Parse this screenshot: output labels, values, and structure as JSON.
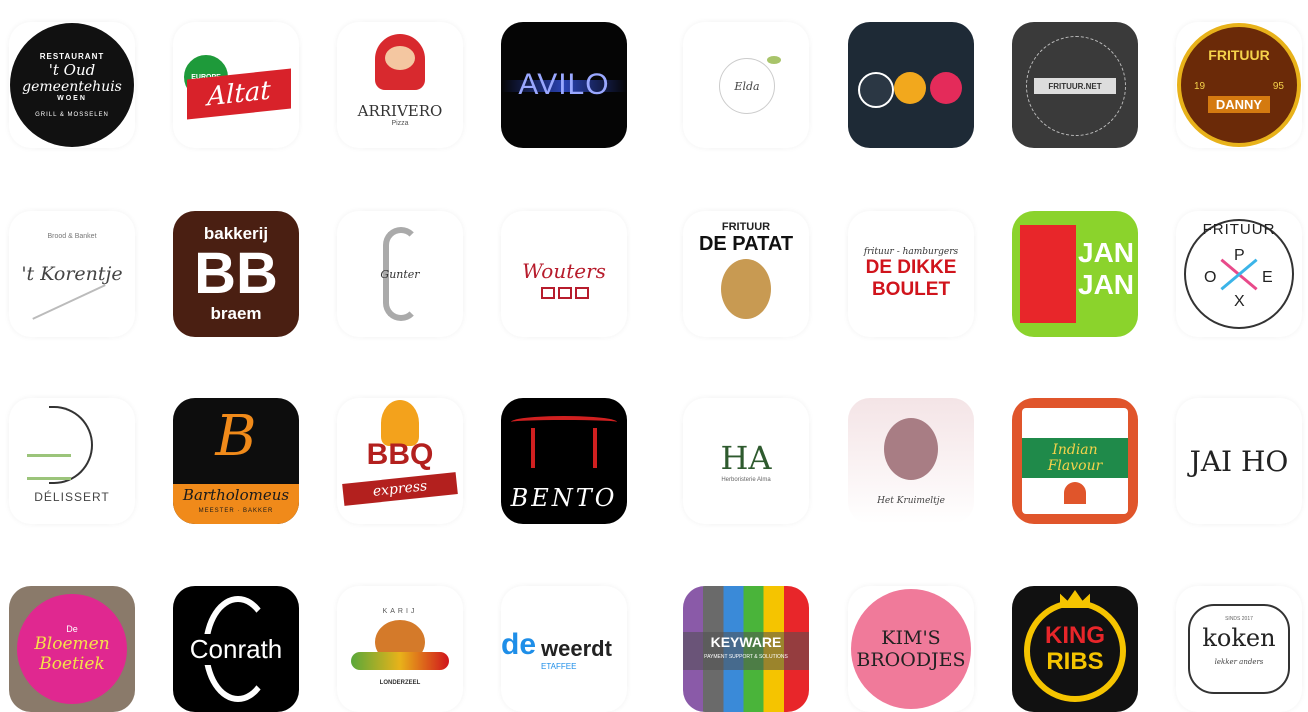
{
  "logos": {
    "oud_gemeentehuis": {
      "top": "RESTAURANT",
      "line1": "'t Oud",
      "line2": "gemeentehuis",
      "line3": "WOEN",
      "bottom": "GRILL & MOSSELEN"
    },
    "altat": {
      "badge": "EUROPE",
      "name": "Altat"
    },
    "arrivero": {
      "name": "ARRIVERO",
      "sub": "Pizza"
    },
    "avilo": {
      "name": "AVILO"
    },
    "elda": {
      "name": "Elda"
    },
    "frituur_net": {
      "name": "FRITUUR.NET"
    },
    "frituur_danny": {
      "top": "FRITUUR",
      "year_left": "19",
      "year_right": "95",
      "name": "DANNY"
    },
    "korentje": {
      "top": "Brood & Banket",
      "name": "'t Korentje"
    },
    "bakkerij_braem": {
      "top": "bakkerij",
      "mid": "BB",
      "bottom": "braem"
    },
    "gunter": {
      "name": "Gunter"
    },
    "wouters": {
      "name": "Wouters"
    },
    "frituur_de_patat": {
      "top": "FRITUUR",
      "name": "DE PATAT"
    },
    "dikke_boulet": {
      "top": "frituur - hamburgers",
      "line1": "DE DIKKE",
      "line2": "BOULET"
    },
    "jan_jan": {
      "line1": "JAN",
      "line2": "JAN"
    },
    "frituur_opex": {
      "top": "FRITUUR",
      "o": "O",
      "p": "P",
      "e": "E",
      "x": "X"
    },
    "delissert": {
      "name": "DÉLISSERT"
    },
    "bartholomeus": {
      "letter": "B",
      "name": "Bartholomeus",
      "sub": "MEESTER · BAKKER"
    },
    "bbq_express": {
      "name": "BBQ",
      "ribbon": "express"
    },
    "bento": {
      "name": "BENTO"
    },
    "ha": {
      "name": "HA",
      "sub": "Herboristerie Alma"
    },
    "het_kruimeltje": {
      "name": "Het Kruimeltje"
    },
    "indian_flavour": {
      "line1": "Indian",
      "line2": "Flavour"
    },
    "jai_ho": {
      "name": "JAI HO"
    },
    "bloemen_boetiek": {
      "top": "De",
      "line1": "Bloemen",
      "line2": "Boetiek"
    },
    "conrath": {
      "name": "Conrath"
    },
    "londerzeel": {
      "top": "KARIJ",
      "name": "LONDERZEEL"
    },
    "de_weerdt": {
      "de": "de",
      "name": "weerdt",
      "sub": "ETAFFEE"
    },
    "keyware": {
      "name": "KEYWARE",
      "sub": "PAYMENT SUPPORT & SOLUTIONS"
    },
    "kims_broodjes": {
      "line1": "KIM'S",
      "line2": "BROODJES"
    },
    "king_ribs": {
      "line1": "KING",
      "line2": "RIBS"
    },
    "koken": {
      "name": "koken",
      "top": "SINDS 2017",
      "sub": "lekker anders"
    }
  },
  "colors": {
    "altat_red": "#d8222a",
    "avilo_blue": "#4a6cff",
    "danny_brown": "#6b2a08",
    "braem_brown": "#4a1f12",
    "jan_green": "#8bd32c",
    "bartholomeus_orange": "#f08a1a",
    "bbq_red": "#b3201e",
    "bento_red": "#d02020",
    "kim_pink": "#f07a9a",
    "king_yellow": "#f5c400"
  }
}
